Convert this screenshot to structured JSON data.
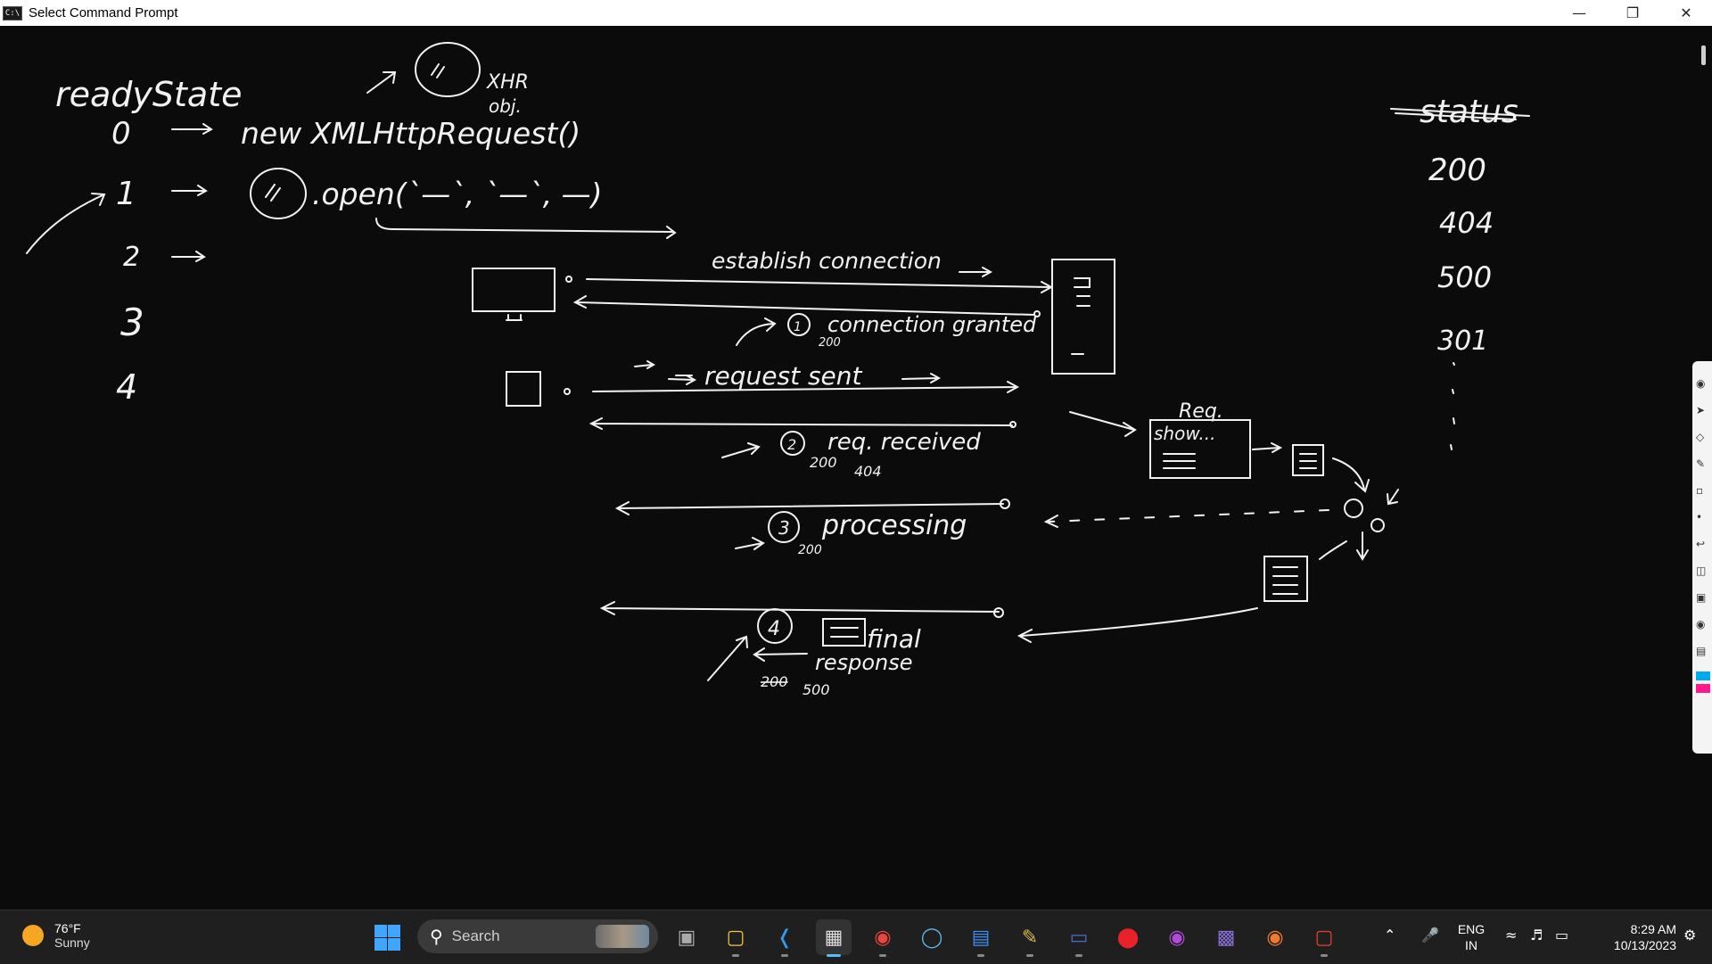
{
  "window": {
    "title": "Select Command Prompt",
    "icon_label": "C:\\",
    "minimize_icon": "minimize-icon",
    "maximize_icon": "restore-icon",
    "close_icon": "close-icon"
  },
  "whiteboard": {
    "ready_state_heading": "readyState",
    "status_heading": "status",
    "xhr_label_line1": "XHR",
    "xhr_label_line2": "obj.",
    "states": [
      {
        "num": "0",
        "text": "new XMLHttpRequest()"
      },
      {
        "num": "1",
        "text": ".open(`—`, `—`, —)"
      },
      {
        "num": "2",
        "text": ""
      },
      {
        "num": "3",
        "text": ""
      },
      {
        "num": "4",
        "text": ""
      }
    ],
    "status_codes": [
      "200",
      "404",
      "500",
      "301"
    ],
    "flow": {
      "establish": "establish connection",
      "connection_granted": "connection granted",
      "step1": "1",
      "code1": "200",
      "request_sent": "request sent",
      "req_received": "req. received",
      "step2": "2",
      "code2a": "200",
      "code2b": "404",
      "processing": "processing",
      "step3": "3",
      "code3": "200",
      "final": "final",
      "response": "response",
      "step4": "4",
      "code4a": "200",
      "code4b": "500",
      "req_label": "Req.",
      "req_box_label": "show..."
    }
  },
  "taskbar": {
    "weather_temp": "76°F",
    "weather_desc": "Sunny",
    "search_placeholder": "Search",
    "lang_line1": "ENG",
    "lang_line2": "IN",
    "time": "8:29 AM",
    "date": "10/13/2023",
    "apps": [
      "task-view",
      "file-explorer",
      "vscode",
      "terminal",
      "chrome",
      "edge-globe",
      "notepad",
      "paint-brush",
      "app-window",
      "opera",
      "app-mask",
      "app-grid",
      "firefox",
      "app-red"
    ]
  }
}
